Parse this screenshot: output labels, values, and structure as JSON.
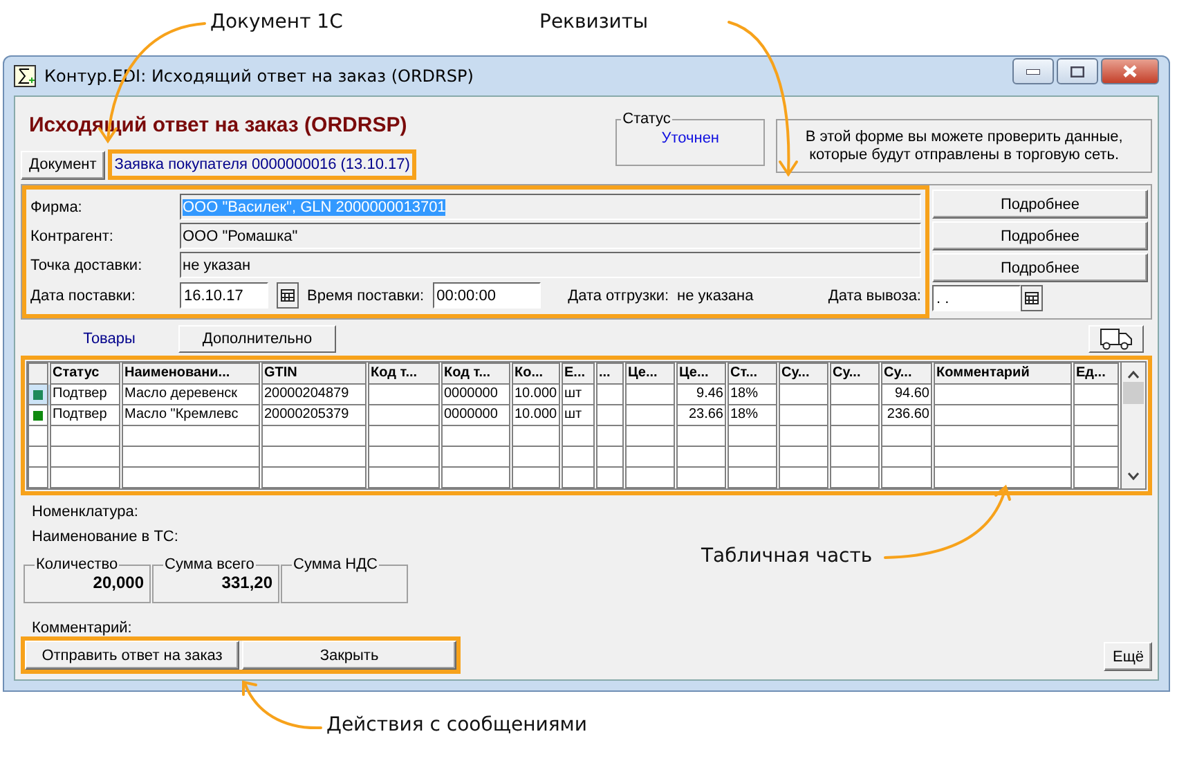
{
  "callouts": [
    {
      "text": "Документ 1С"
    },
    {
      "text": "Реквизиты"
    },
    {
      "text": "Табличная часть"
    },
    {
      "text": "Действия с сообщениями"
    }
  ],
  "window": {
    "title": "Контур.EDI: Исходящий ответ на заказ (ORDRSP)"
  },
  "header": {
    "title": "Исходящий ответ на заказ (ORDRSP)",
    "document_button": "Документ",
    "document_link": "Заявка покупателя 0000000016 (13.10.17)"
  },
  "status": {
    "label": "Статус",
    "value": "Уточнен"
  },
  "info": "В этой форме вы можете проверить данные, которые будут отправлены в торговую сеть.",
  "fields": [
    {
      "label": "Фирма:",
      "value": "ООО \"Василек\", GLN 2000000013701",
      "selected": true,
      "button": "Подробнее"
    },
    {
      "label": "Контрагент:",
      "value": "ООО \"Ромашка\"",
      "selected": false,
      "button": "Подробнее"
    },
    {
      "label": "Точка доставки:",
      "value": "не указан",
      "selected": false,
      "button": "Подробнее"
    }
  ],
  "dates": {
    "delivery_date_label": "Дата поставки:",
    "delivery_date": "16.10.17",
    "delivery_time_label": "Время поставки:",
    "delivery_time": "00:00:00",
    "shipment_label": "Дата отгрузки:",
    "shipment_value": "не указана",
    "pickup_label": "Дата вывоза:",
    "pickup_value": ". ."
  },
  "tabs": [
    {
      "label": "Товары",
      "selected": true
    },
    {
      "label": "Дополнительно",
      "selected": false
    }
  ],
  "table": {
    "columns": [
      "Статус",
      "Наименовани...",
      "GTIN",
      "Код т...",
      "Код т...",
      "Ко...",
      "Е...",
      "...",
      "Це...",
      "Це...",
      "Ст...",
      "Су...",
      "Су...",
      "Су...",
      "Комментарий",
      "Ед..."
    ],
    "rows": [
      {
        "color": "#1e8a5a",
        "selected": true,
        "cells": [
          "Подтвер",
          "Масло деревенск",
          "20000204879",
          null,
          "0000000",
          "10.000",
          "шт",
          null,
          null,
          "9.46",
          "18%",
          null,
          null,
          "94.60",
          null,
          null
        ]
      },
      {
        "color": "#108a10",
        "selected": false,
        "cells": [
          "Подтвер",
          "Масло \"Кремлевс",
          "20000205379",
          null,
          "0000000",
          "10.000",
          "шт",
          null,
          null,
          "23.66",
          "18%",
          null,
          null,
          "236.60",
          null,
          null
        ]
      }
    ]
  },
  "nomenclature_label": "Номенклатура:",
  "ts_name_label": "Наименование в ТС:",
  "totals": [
    {
      "label": "Количество",
      "value": "20,000"
    },
    {
      "label": "Сумма всего",
      "value": "331,20"
    },
    {
      "label": "Сумма НДС"
    }
  ],
  "comment_label": "Комментарий:",
  "actions": [
    "Отправить ответ на заказ",
    "Закрыть"
  ],
  "more_button": "Ещё"
}
